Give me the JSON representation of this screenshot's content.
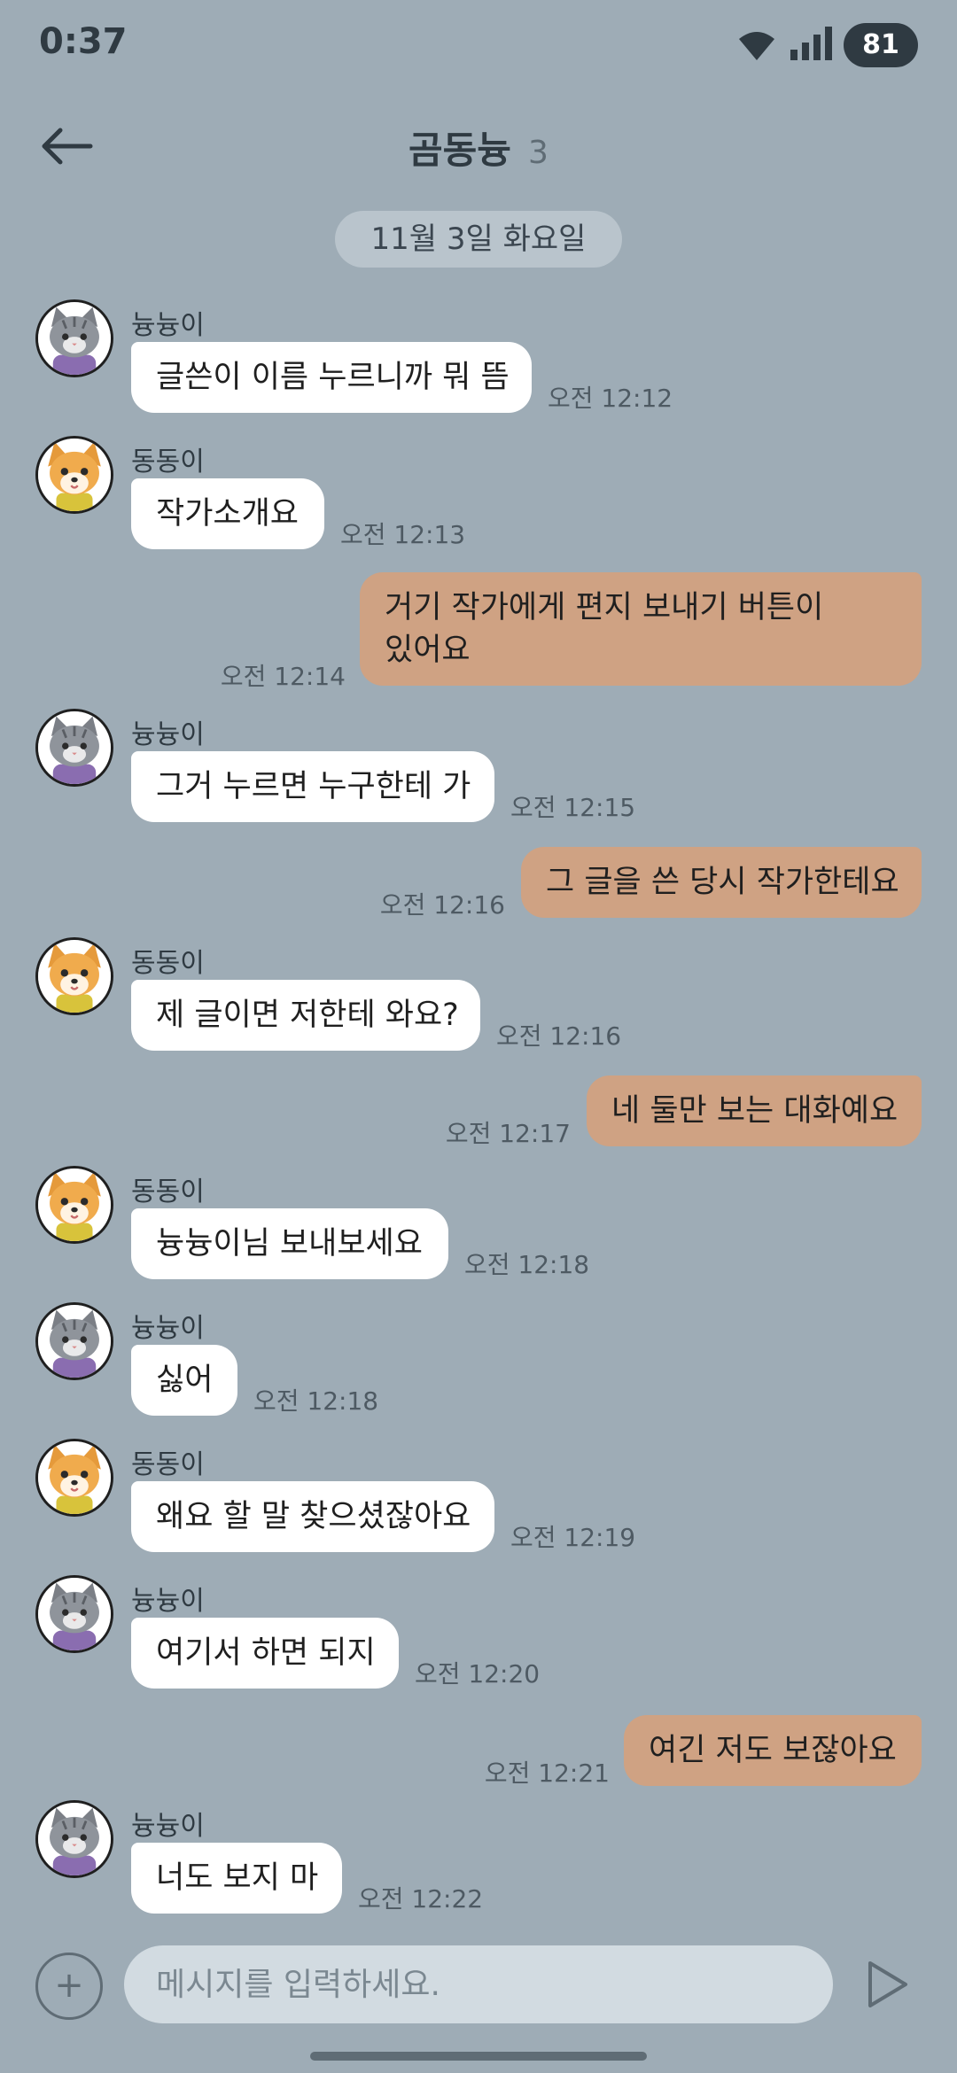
{
  "status": {
    "time": "0:37",
    "battery": "81"
  },
  "header": {
    "title": "곰동늉",
    "member_count": "3"
  },
  "date_divider": "11월 3일 화요일",
  "messages": [
    {
      "dir": "in",
      "sender": "늉늉이",
      "avatar": "cat",
      "text": "글쓴이 이름 누르니까 뭐 뜸",
      "time": "오전 12:12"
    },
    {
      "dir": "in",
      "sender": "동동이",
      "avatar": "dog",
      "text": "작가소개요",
      "time": "오전 12:13"
    },
    {
      "dir": "out",
      "text_lines": [
        "거기 작가에게 편지 보내기 버튼이",
        "있어요"
      ],
      "time": "오전 12:14"
    },
    {
      "dir": "in",
      "sender": "늉늉이",
      "avatar": "cat",
      "text": "그거 누르면 누구한테 가",
      "time": "오전 12:15"
    },
    {
      "dir": "out",
      "text": "그 글을 쓴 당시 작가한테요",
      "time": "오전 12:16"
    },
    {
      "dir": "in",
      "sender": "동동이",
      "avatar": "dog",
      "text": "제 글이면 저한테 와요?",
      "time": "오전 12:16"
    },
    {
      "dir": "out",
      "text": "네 둘만 보는 대화예요",
      "time": "오전 12:17"
    },
    {
      "dir": "in",
      "sender": "동동이",
      "avatar": "dog",
      "text": "늉늉이님 보내보세요",
      "time": "오전 12:18"
    },
    {
      "dir": "in",
      "sender": "늉늉이",
      "avatar": "cat",
      "text": "싫어",
      "time": "오전 12:18"
    },
    {
      "dir": "in",
      "sender": "동동이",
      "avatar": "dog",
      "text": "왜요 할 말 찾으셨잖아요",
      "time": "오전 12:19"
    },
    {
      "dir": "in",
      "sender": "늉늉이",
      "avatar": "cat",
      "text": "여기서 하면 되지",
      "time": "오전 12:20"
    },
    {
      "dir": "out",
      "text": "여긴 저도 보잖아요",
      "time": "오전 12:21"
    },
    {
      "dir": "in",
      "sender": "늉늉이",
      "avatar": "cat",
      "text": "너도 보지 마",
      "time": "오전 12:22"
    }
  ],
  "composer": {
    "placeholder": "메시지를 입력하세요."
  },
  "colors": {
    "background": "#9eacb6",
    "outgoing_bubble": "#cfa283",
    "incoming_bubble": "#ffffff"
  },
  "icons": {
    "back": "arrow-left-icon",
    "add": "plus-icon",
    "send": "send-icon"
  }
}
